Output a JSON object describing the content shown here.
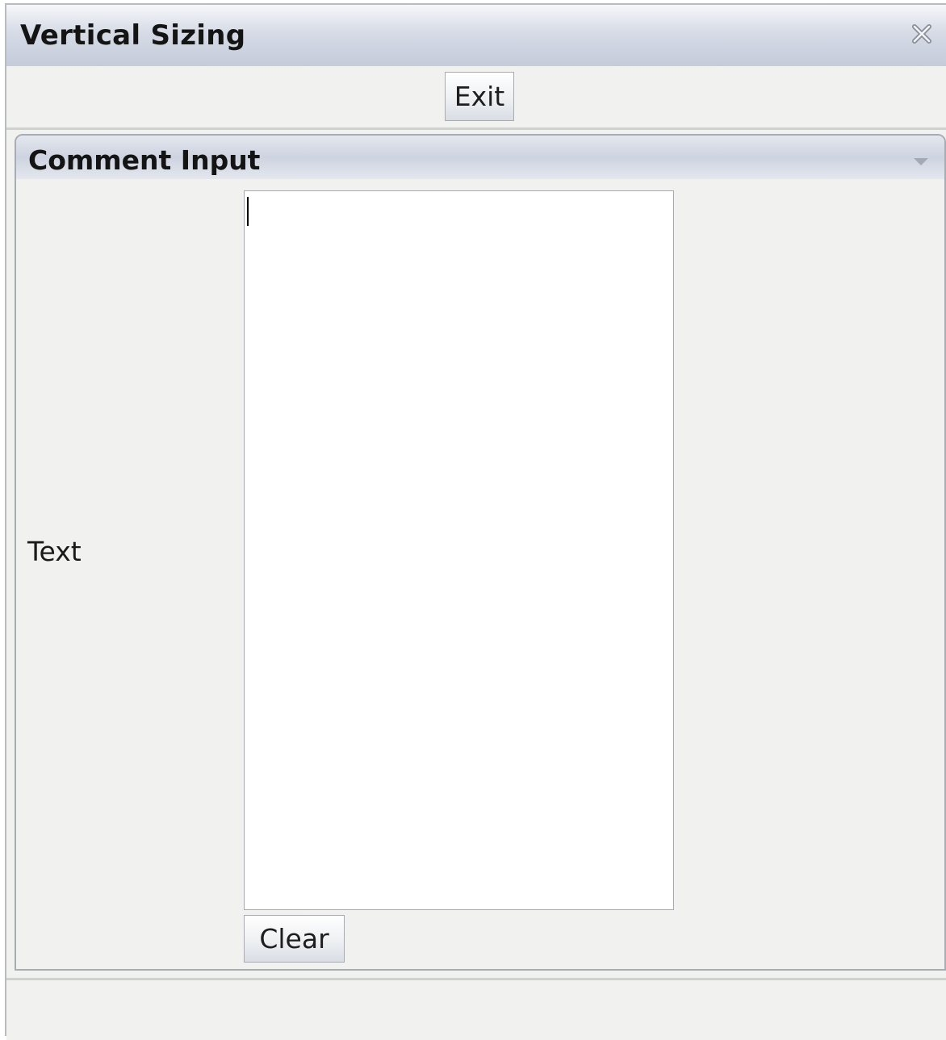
{
  "window": {
    "title": "Vertical Sizing",
    "close_icon": "close-icon"
  },
  "toolbar": {
    "exit_label": "Exit"
  },
  "panel": {
    "title": "Comment Input",
    "collapse_icon": "chevron-down-icon",
    "field_label": "Text",
    "text_value": "",
    "clear_label": "Clear"
  },
  "colors": {
    "background": "#f1f2ef",
    "header_gradient_mid": "#cdd3e0",
    "border": "#a8adb3"
  }
}
